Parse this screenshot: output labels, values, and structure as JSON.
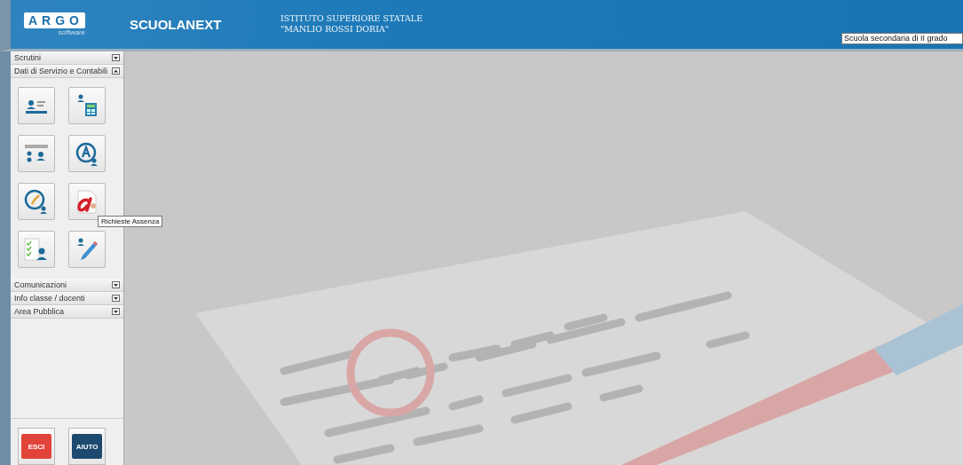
{
  "header": {
    "logo": "ARGO",
    "logo_sub": "software",
    "brand": "SCUOLANEXT",
    "institute": "ISTITUTO SUPERIORE STATALE \"MANLIO ROSSI DORIA\"",
    "school_select": {
      "value": "Scuola secondaria di II grado"
    }
  },
  "sidebar": {
    "sections": [
      {
        "label": "Scrutini",
        "expanded": false
      },
      {
        "label": "Dati di Servizio e Contabili",
        "expanded": true,
        "tiles": [
          {
            "kind": "card"
          },
          {
            "kind": "calculator"
          },
          {
            "kind": "list"
          },
          {
            "kind": "letter"
          },
          {
            "kind": "clock"
          },
          {
            "kind": "absence",
            "tooltip": "Richieste Assenza"
          },
          {
            "kind": "checklist"
          },
          {
            "kind": "pencil"
          }
        ]
      },
      {
        "label": "Comunicazioni",
        "expanded": false
      },
      {
        "label": "Info classe / docenti",
        "expanded": false
      },
      {
        "label": "Area Pubblica",
        "expanded": false
      }
    ],
    "buttons": [
      {
        "label": "ESCI",
        "kind": "exit"
      },
      {
        "label": "AIUTO",
        "kind": "help"
      }
    ]
  }
}
